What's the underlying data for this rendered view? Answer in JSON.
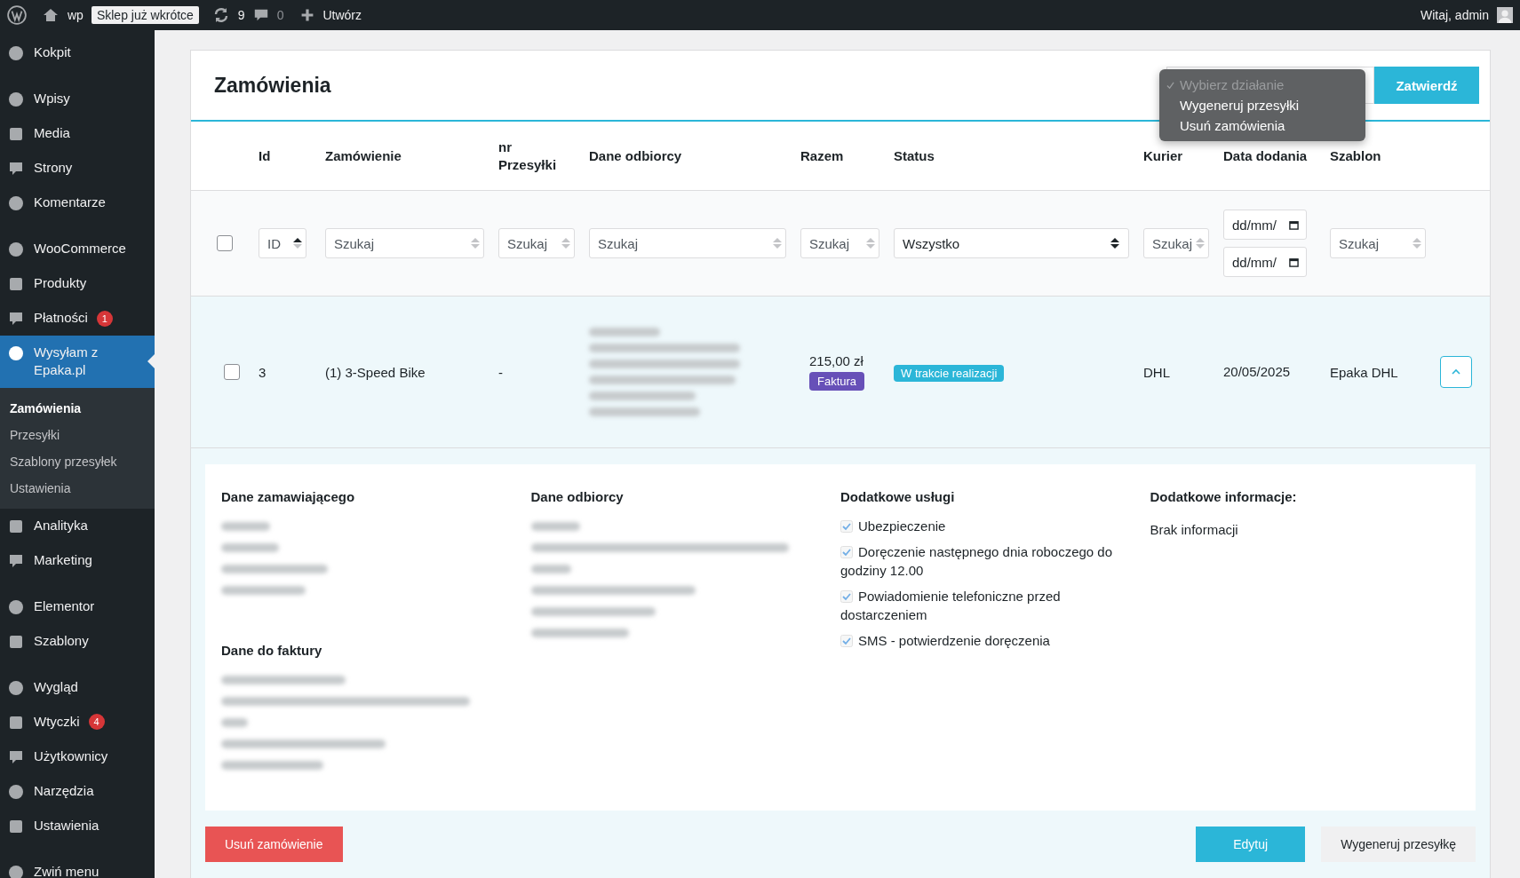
{
  "admin_bar": {
    "site": "wp",
    "badge": "Sklep już wkrótce",
    "updates": "9",
    "comments": "0",
    "new": "Utwórz",
    "greeting": "Witaj, admin"
  },
  "menu_groups": [
    [
      {
        "label": "Kokpit",
        "selected": false
      }
    ],
    [
      {
        "label": "Wpisy",
        "selected": false
      },
      {
        "label": "Media",
        "selected": false
      },
      {
        "label": "Strony",
        "selected": false
      },
      {
        "label": "Komentarze",
        "selected": false
      }
    ],
    [
      {
        "label": "WooCommerce",
        "selected": false
      },
      {
        "label": "Produkty",
        "selected": false
      },
      {
        "label": "Płatności",
        "selected": false,
        "count": "1"
      },
      {
        "label": "Wysyłam z Epaka.pl",
        "selected": true,
        "children": [
          {
            "label": "Zamówienia",
            "selected": true
          },
          {
            "label": "Przesyłki",
            "selected": false
          },
          {
            "label": "Szablony przesyłek",
            "selected": false
          },
          {
            "label": "Ustawienia",
            "selected": false
          }
        ]
      },
      {
        "label": "Analityka",
        "selected": false
      },
      {
        "label": "Marketing",
        "selected": false
      }
    ],
    [
      {
        "label": "Elementor",
        "selected": false
      },
      {
        "label": "Szablony",
        "selected": false
      }
    ],
    [
      {
        "label": "Wygląd",
        "selected": false
      },
      {
        "label": "Wtyczki",
        "selected": false,
        "count": "4"
      },
      {
        "label": "Użytkownicy",
        "selected": false
      },
      {
        "label": "Narzędzia",
        "selected": false
      },
      {
        "label": "Ustawienia",
        "selected": false
      }
    ],
    [
      {
        "label": "Zwiń menu",
        "selected": false
      }
    ]
  ],
  "page": {
    "title": "Zamówienia",
    "apply_button": "Zatwierdź",
    "bulk_dropdown": [
      {
        "label": "Wybierz działanie",
        "selected": true
      },
      {
        "label": "Wygeneruj przesyłki",
        "selected": false
      },
      {
        "label": "Usuń zamówienia",
        "selected": false
      }
    ]
  },
  "table": {
    "select_all": {
      "checked": false
    },
    "columns": [
      "Id",
      "Zamówienie",
      "nr Przesyłki",
      "Dane odbiorcy",
      "Razem",
      "Status",
      "Kurier",
      "Data dodania",
      "Szablon"
    ],
    "filters": [
      {
        "kind": "sort",
        "value": "ID"
      },
      {
        "kind": "text",
        "placeholder": "Szukaj"
      },
      {
        "kind": "text",
        "placeholder": "Szukaj"
      },
      {
        "kind": "text",
        "placeholder": "Szukaj"
      },
      {
        "kind": "text",
        "placeholder": "Szukaj"
      },
      {
        "kind": "select",
        "value": "Wszystko"
      },
      {
        "kind": "text",
        "placeholder": "Szukaj"
      },
      {
        "kind": "dates",
        "values": [
          "dd/mm/",
          "dd/mm/"
        ]
      },
      {
        "kind": "text",
        "placeholder": "Szukaj"
      }
    ],
    "rows": [
      {
        "checked": false,
        "expanded": true,
        "id": "3",
        "order": "(1) 3-Speed Bike",
        "shipment": "-",
        "total": "215,00 zł",
        "invoice": "Faktura",
        "status": "W trakcie realizacji",
        "courier": "DHL",
        "date": "20/05/2025",
        "template": "Epaka DHL"
      }
    ]
  },
  "details": {
    "orderer_title": "Dane zamawiającego",
    "invoice_title": "Dane do faktury",
    "recipient_title": "Dane odbiorcy",
    "services_title": "Dodatkowe usługi",
    "services": [
      {
        "label": "Ubezpieczenie",
        "checked": true
      },
      {
        "label": "Doręczenie następnego dnia roboczego do godziny 12.00",
        "checked": true
      },
      {
        "label": "Powiadomienie telefoniczne przed dostarczeniem",
        "checked": true
      },
      {
        "label": "SMS - potwierdzenie doręczenia",
        "checked": true
      }
    ],
    "info_title": "Dodatkowe informacje:",
    "info": "Brak informacji",
    "delete_button": "Usuń zamówienie",
    "edit_button": "Edytuj",
    "generate_button": "Wygeneruj przesyłkę"
  }
}
